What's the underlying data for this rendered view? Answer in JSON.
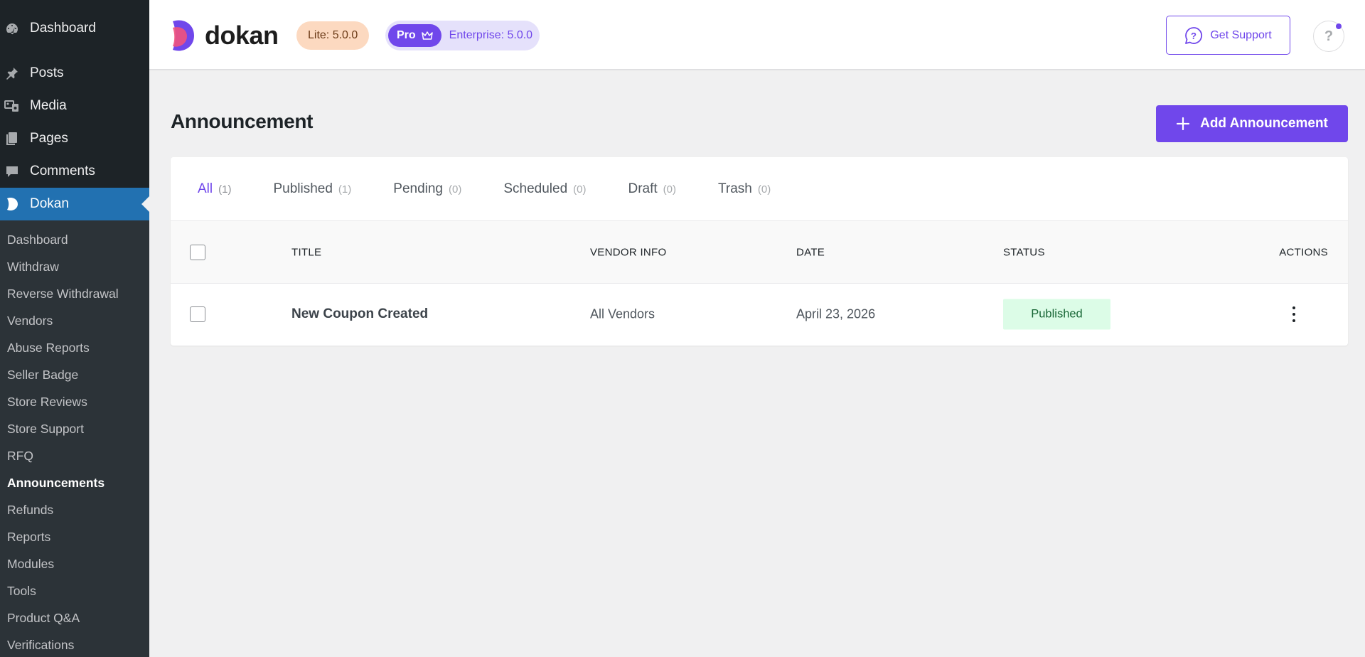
{
  "sidebar": {
    "main_items": [
      {
        "label": "Dashboard",
        "icon": "dashboard-icon"
      },
      {
        "label": "Posts",
        "icon": "pin-icon"
      },
      {
        "label": "Media",
        "icon": "media-icon"
      },
      {
        "label": "Pages",
        "icon": "pages-icon"
      },
      {
        "label": "Comments",
        "icon": "comment-icon"
      },
      {
        "label": "Dokan",
        "icon": "dokan-icon"
      }
    ],
    "sub_items": [
      "Dashboard",
      "Withdraw",
      "Reverse Withdrawal",
      "Vendors",
      "Abuse Reports",
      "Seller Badge",
      "Store Reviews",
      "Store Support",
      "RFQ",
      "Announcements",
      "Refunds",
      "Reports",
      "Modules",
      "Tools",
      "Product Q&A",
      "Verifications"
    ],
    "current_sub": "Announcements"
  },
  "header": {
    "logo_text": "dokan",
    "lite_badge": "Lite: 5.0.0",
    "pro_label": "Pro",
    "enterprise_label": "Enterprise: 5.0.0",
    "support_label": "Get Support",
    "help_label": "?"
  },
  "page": {
    "title": "Announcement",
    "add_button": "Add Announcement"
  },
  "tabs": [
    {
      "label": "All",
      "count": "(1)"
    },
    {
      "label": "Published",
      "count": "(1)"
    },
    {
      "label": "Pending",
      "count": "(0)"
    },
    {
      "label": "Scheduled",
      "count": "(0)"
    },
    {
      "label": "Draft",
      "count": "(0)"
    },
    {
      "label": "Trash",
      "count": "(0)"
    }
  ],
  "table": {
    "columns": {
      "title": "TITLE",
      "vendor": "VENDOR INFO",
      "date": "DATE",
      "status": "STATUS",
      "actions": "ACTIONS"
    },
    "rows": [
      {
        "title": "New Coupon Created",
        "vendor": "All Vendors",
        "date": "April 23, 2026",
        "status": "Published"
      }
    ]
  },
  "colors": {
    "accent": "#7047eb",
    "sidebar_bg": "#1d2327",
    "sidebar_active": "#2271b1",
    "status_published_bg": "#dcfce7",
    "status_published_text": "#166534"
  }
}
